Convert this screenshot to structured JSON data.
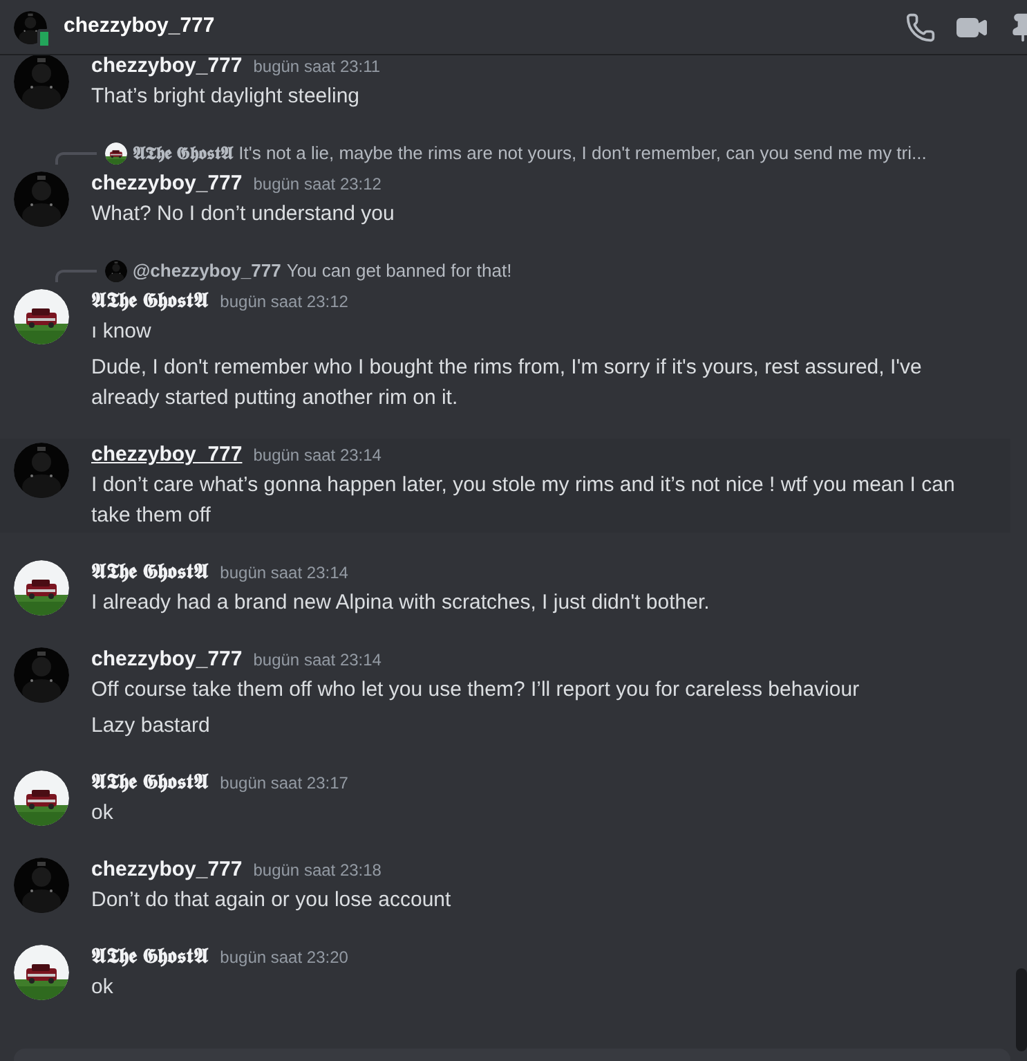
{
  "header": {
    "title": "chezzyboy_777"
  },
  "messages": [
    {
      "author": "chezzyboy_777",
      "time": "bugün saat 23:11",
      "hovered": false,
      "lines": [
        "That’s bright daylight steeling"
      ]
    },
    {
      "author": "chezzyboy_777",
      "time": "bugün saat 23:12",
      "hovered": false,
      "reply": {
        "author": "𝕬𝕿𝖍𝖊 𝕲𝖍𝖔𝖘𝖙𝕬",
        "text": "It's not a lie, maybe the rims are not yours, I don't remember, can you send me my tri..."
      },
      "lines": [
        "What? No I don’t understand you"
      ]
    },
    {
      "author": "𝕬𝕿𝖍𝖊 𝕲𝖍𝖔𝖘𝖙𝕬",
      "time": "bugün saat 23:12",
      "hovered": false,
      "reply": {
        "author": "@chezzyboy_777",
        "text": "You can get banned for that!"
      },
      "lines": [
        "ı know",
        "Dude, I don't remember who I bought the rims from, I'm sorry if it's yours, rest assured, I've already started putting another rim on it."
      ]
    },
    {
      "author": "chezzyboy_777",
      "time": "bugün saat 23:14",
      "hovered": true,
      "lines": [
        "I don’t care what’s gonna happen later, you stole my rims and it’s not nice ! wtf you mean I can take them off"
      ]
    },
    {
      "author": "𝕬𝕿𝖍𝖊 𝕲𝖍𝖔𝖘𝖙𝕬",
      "time": "bugün saat 23:14",
      "hovered": false,
      "lines": [
        "I already had a brand new Alpina with scratches, I just didn't bother."
      ]
    },
    {
      "author": "chezzyboy_777",
      "time": "bugün saat 23:14",
      "hovered": false,
      "lines": [
        "Off course take them off who let you use them? I’ll report you for careless behaviour",
        "Lazy bastard"
      ]
    },
    {
      "author": "𝕬𝕿𝖍𝖊 𝕲𝖍𝖔𝖘𝖙𝕬",
      "time": "bugün saat 23:17",
      "hovered": false,
      "lines": [
        "ok"
      ]
    },
    {
      "author": "chezzyboy_777",
      "time": "bugün saat 23:18",
      "hovered": false,
      "lines": [
        "Don’t do that again or you lose account"
      ]
    },
    {
      "author": "𝕬𝕿𝖍𝖊 𝕲𝖍𝖔𝖘𝖙𝕬",
      "time": "bugün saat 23:20",
      "hovered": false,
      "lines": [
        "ok"
      ]
    }
  ]
}
